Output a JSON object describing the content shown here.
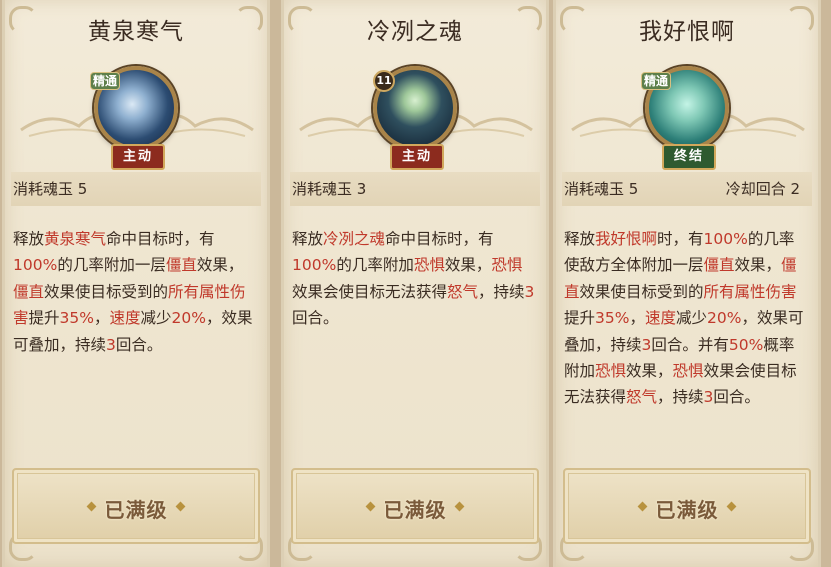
{
  "cards": [
    {
      "title": "黄泉寒气",
      "orb_tag": "精通",
      "badge": "主动",
      "cost_label": "消耗魂玉 5",
      "cooldown_label": "",
      "description": [
        {
          "t": "释放",
          "s": "n"
        },
        {
          "t": "黄泉寒气",
          "s": "k"
        },
        {
          "t": "命中目标时，有",
          "s": "n"
        },
        {
          "t": "100%",
          "s": "k"
        },
        {
          "t": "的几率附加一层",
          "s": "n"
        },
        {
          "t": "僵直",
          "s": "k"
        },
        {
          "t": "效果，",
          "s": "n"
        },
        {
          "t": "僵直",
          "s": "k"
        },
        {
          "t": "效果使目标受到的",
          "s": "n"
        },
        {
          "t": "所有属性伤害",
          "s": "k"
        },
        {
          "t": "提升",
          "s": "n"
        },
        {
          "t": "35%",
          "s": "k"
        },
        {
          "t": "，",
          "s": "n"
        },
        {
          "t": "速度",
          "s": "k"
        },
        {
          "t": "减少",
          "s": "n"
        },
        {
          "t": "20%",
          "s": "k"
        },
        {
          "t": "，效果可叠加，持续",
          "s": "n"
        },
        {
          "t": "3",
          "s": "k"
        },
        {
          "t": "回合。",
          "s": "n"
        }
      ],
      "button": "已满级"
    },
    {
      "title": "冷冽之魂",
      "orb_level": "11",
      "badge": "主动",
      "cost_label": "消耗魂玉 3",
      "cooldown_label": "",
      "description": [
        {
          "t": "释放",
          "s": "n"
        },
        {
          "t": "冷冽之魂",
          "s": "k"
        },
        {
          "t": "命中目标时，有",
          "s": "n"
        },
        {
          "t": "100%",
          "s": "k"
        },
        {
          "t": "的几率附加",
          "s": "n"
        },
        {
          "t": "恐惧",
          "s": "k"
        },
        {
          "t": "效果，",
          "s": "n"
        },
        {
          "t": "恐惧",
          "s": "k"
        },
        {
          "t": "效果会使目标无法获得",
          "s": "n"
        },
        {
          "t": "怒气",
          "s": "k"
        },
        {
          "t": "，持续",
          "s": "n"
        },
        {
          "t": "3",
          "s": "k"
        },
        {
          "t": "回合。",
          "s": "n"
        }
      ],
      "button": "已满级"
    },
    {
      "title": "我好恨啊",
      "orb_tag": "精通",
      "badge": "终结",
      "cost_label": "消耗魂玉 5",
      "cooldown_label": "冷却回合 2",
      "description": [
        {
          "t": "释放",
          "s": "n"
        },
        {
          "t": "我好恨啊",
          "s": "k"
        },
        {
          "t": "时，有",
          "s": "n"
        },
        {
          "t": "100%",
          "s": "k"
        },
        {
          "t": "的几率使敌方全体附加一层",
          "s": "n"
        },
        {
          "t": "僵直",
          "s": "k"
        },
        {
          "t": "效果，",
          "s": "n"
        },
        {
          "t": "僵直",
          "s": "k"
        },
        {
          "t": "效果使目标受到的",
          "s": "n"
        },
        {
          "t": "所有属性伤害",
          "s": "k"
        },
        {
          "t": "提升",
          "s": "n"
        },
        {
          "t": "35%",
          "s": "k"
        },
        {
          "t": "，",
          "s": "n"
        },
        {
          "t": "速度",
          "s": "k"
        },
        {
          "t": "减少",
          "s": "n"
        },
        {
          "t": "20%",
          "s": "k"
        },
        {
          "t": "，效果可叠加，持续",
          "s": "n"
        },
        {
          "t": "3",
          "s": "k"
        },
        {
          "t": "回合。并有",
          "s": "n"
        },
        {
          "t": "50%",
          "s": "k"
        },
        {
          "t": "概率附加",
          "s": "n"
        },
        {
          "t": "恐惧",
          "s": "k"
        },
        {
          "t": "效果，",
          "s": "n"
        },
        {
          "t": "恐惧",
          "s": "k"
        },
        {
          "t": "效果会使目标无法获得",
          "s": "n"
        },
        {
          "t": "怒气",
          "s": "k"
        },
        {
          "t": "，持续",
          "s": "n"
        },
        {
          "t": "3",
          "s": "k"
        },
        {
          "t": "回合。",
          "s": "n"
        }
      ],
      "button": "已满级"
    }
  ],
  "colors": {
    "keyword": "#c0392b",
    "text": "#3a2c22",
    "active_badge": "#8c2b1e",
    "finisher_badge": "#2e5a30"
  }
}
